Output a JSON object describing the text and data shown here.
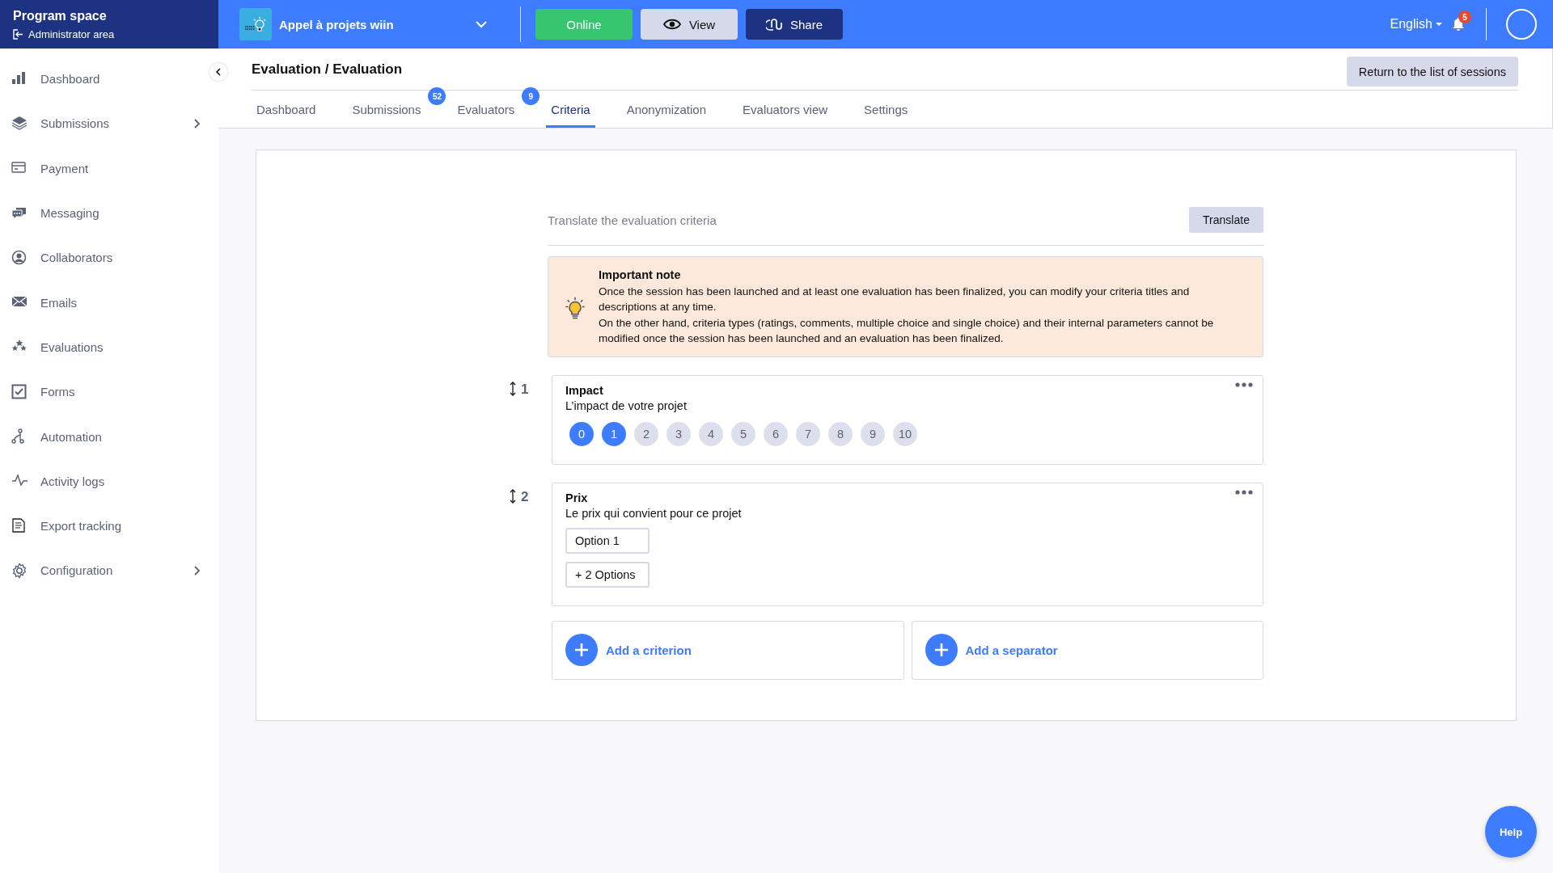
{
  "brand": {
    "title": "Program space",
    "subtitle": "Administrator area"
  },
  "topbar": {
    "program": "Appel à projets wiin",
    "status": "Online",
    "view": "View",
    "share": "Share",
    "language": "English",
    "notifications": "5"
  },
  "sidebar": {
    "items": [
      {
        "label": "Dashboard",
        "has_submenu": false
      },
      {
        "label": "Submissions",
        "has_submenu": true
      },
      {
        "label": "Payment",
        "has_submenu": false
      },
      {
        "label": "Messaging",
        "has_submenu": false
      },
      {
        "label": "Collaborators",
        "has_submenu": false
      },
      {
        "label": "Emails",
        "has_submenu": false
      },
      {
        "label": "Evaluations",
        "has_submenu": false
      },
      {
        "label": "Forms",
        "has_submenu": false
      },
      {
        "label": "Automation",
        "has_submenu": false
      },
      {
        "label": "Activity logs",
        "has_submenu": false
      },
      {
        "label": "Export tracking",
        "has_submenu": false
      },
      {
        "label": "Configuration",
        "has_submenu": true
      }
    ]
  },
  "page": {
    "title": "Evaluation / Evaluation",
    "return_button": "Return to the list of sessions"
  },
  "tabs": [
    {
      "label": "Dashboard",
      "selected": false
    },
    {
      "label": "Submissions",
      "badge": "52",
      "selected": false
    },
    {
      "label": "Evaluators",
      "badge": "9",
      "selected": false
    },
    {
      "label": "Criteria",
      "selected": true
    },
    {
      "label": "Anonymization",
      "selected": false
    },
    {
      "label": "Evaluators view",
      "selected": false
    },
    {
      "label": "Settings",
      "selected": false
    }
  ],
  "translate": {
    "label": "Translate the evaluation criteria",
    "button": "Translate"
  },
  "note": {
    "title": "Important note",
    "lines": [
      "Once the session has been launched and at least one evaluation has been finalized, you can modify your criteria titles and descriptions at any time.",
      "On the other hand, criteria types (ratings, comments, multiple choice and single choice) and their internal parameters cannot be modified once the session has been launched and an evaluation has been finalized."
    ]
  },
  "criteria": [
    {
      "number": "1",
      "title": "Impact",
      "description": "L’impact de votre projet",
      "kind": "rating",
      "scale": [
        {
          "label": "0",
          "selected": true
        },
        {
          "label": "1",
          "selected": true
        },
        {
          "label": "2",
          "selected": false
        },
        {
          "label": "3",
          "selected": false
        },
        {
          "label": "4",
          "selected": false
        },
        {
          "label": "5",
          "selected": false
        },
        {
          "label": "6",
          "selected": false
        },
        {
          "label": "7",
          "selected": false
        },
        {
          "label": "8",
          "selected": false
        },
        {
          "label": "9",
          "selected": false
        },
        {
          "label": "10",
          "selected": false
        }
      ]
    },
    {
      "number": "2",
      "title": "Prix",
      "description": "Le prix qui convient pour ce projet",
      "kind": "choice",
      "options": [
        "Option 1"
      ],
      "more": "+ 2 Options"
    }
  ],
  "add_buttons": [
    "Add a criterion",
    "Add a separator"
  ],
  "help": "Help"
}
